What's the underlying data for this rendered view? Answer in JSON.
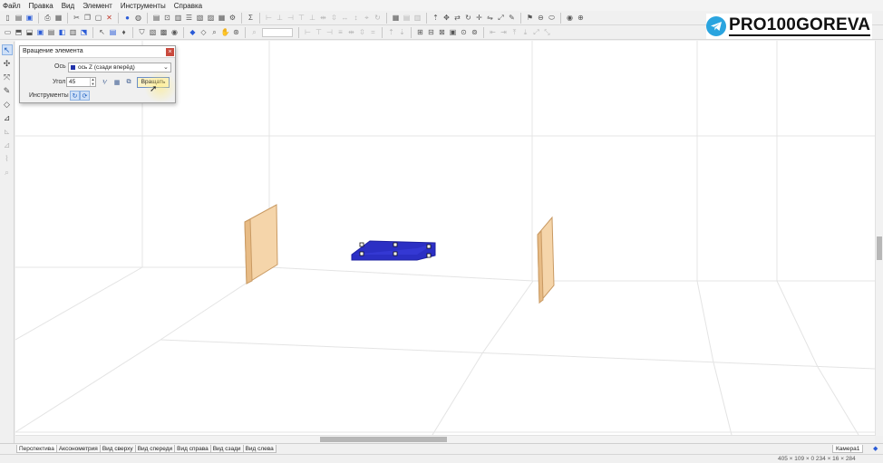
{
  "menu": [
    "Файл",
    "Правка",
    "Вид",
    "Элемент",
    "Инструменты",
    "Справка"
  ],
  "brand": {
    "text": "PRO100GOREVA",
    "icon": "telegram-icon"
  },
  "dialog": {
    "title": "Вращение элемента",
    "close_icon": "close-icon",
    "axis_label": "Ось",
    "axis_value": "ось Z (сзади вперёд)",
    "angle_label": "Угол",
    "angle_value": "45",
    "rotate_button": "Вращать",
    "tools_label": "Инструменты"
  },
  "view_tabs": [
    "Перспектива",
    "Аксонометрия",
    "Вид сверху",
    "Вид спереди",
    "Вид справа",
    "Вид сзади",
    "Вид слева"
  ],
  "camera_tab": "Камера1",
  "status": "405 × 109 × 0   234 × 16 × 284",
  "colors": {
    "selected_part": "#2b2fc4",
    "wood": "#f2cfa0",
    "accent": "#2a5bd7",
    "telegram": "#2aa4df"
  }
}
